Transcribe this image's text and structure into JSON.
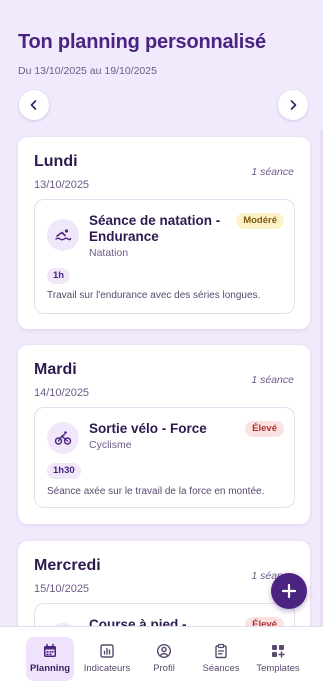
{
  "header": {
    "title": "Ton planning personnalisé",
    "date_range": "Du 13/10/2025 au 19/10/2025",
    "prev_icon": "chevron-left-icon",
    "next_icon": "chevron-right-icon"
  },
  "days": [
    {
      "name": "Lundi",
      "date": "13/10/2025",
      "count": "1 séance",
      "session": {
        "title": "Séance de natation - Endurance",
        "sport": "Natation",
        "sport_icon": "swimming-icon",
        "intensity": "Modéré",
        "duration": "1h",
        "description": "Travail sur l'endurance avec des séries longues."
      }
    },
    {
      "name": "Mardi",
      "date": "14/10/2025",
      "count": "1 séance",
      "session": {
        "title": "Sortie vélo - Force",
        "sport": "Cyclisme",
        "sport_icon": "bike-icon",
        "intensity": "Élevé",
        "duration": "1h30",
        "description": "Séance axée sur le travail de la force en montée."
      }
    },
    {
      "name": "Mercredi",
      "date": "15/10/2025",
      "count": "1 séance",
      "session": {
        "title": "Course à pied -",
        "intensity": "Élevé"
      }
    }
  ],
  "fab_icon": "plus-icon",
  "bottom_nav": [
    {
      "label": "Planning",
      "icon": "calendar-icon",
      "active": true
    },
    {
      "label": "Indicateurs",
      "icon": "chart-icon",
      "active": false
    },
    {
      "label": "Profil",
      "icon": "user-icon",
      "active": false
    },
    {
      "label": "Séances",
      "icon": "clipboard-icon",
      "active": false
    },
    {
      "label": "Templates",
      "icon": "templates-icon",
      "active": false
    }
  ],
  "colors": {
    "background": "#f1e9fc",
    "accent": "#4a2480",
    "moderate_badge": "#fdf1c8",
    "high_badge": "#fbe2e2"
  }
}
